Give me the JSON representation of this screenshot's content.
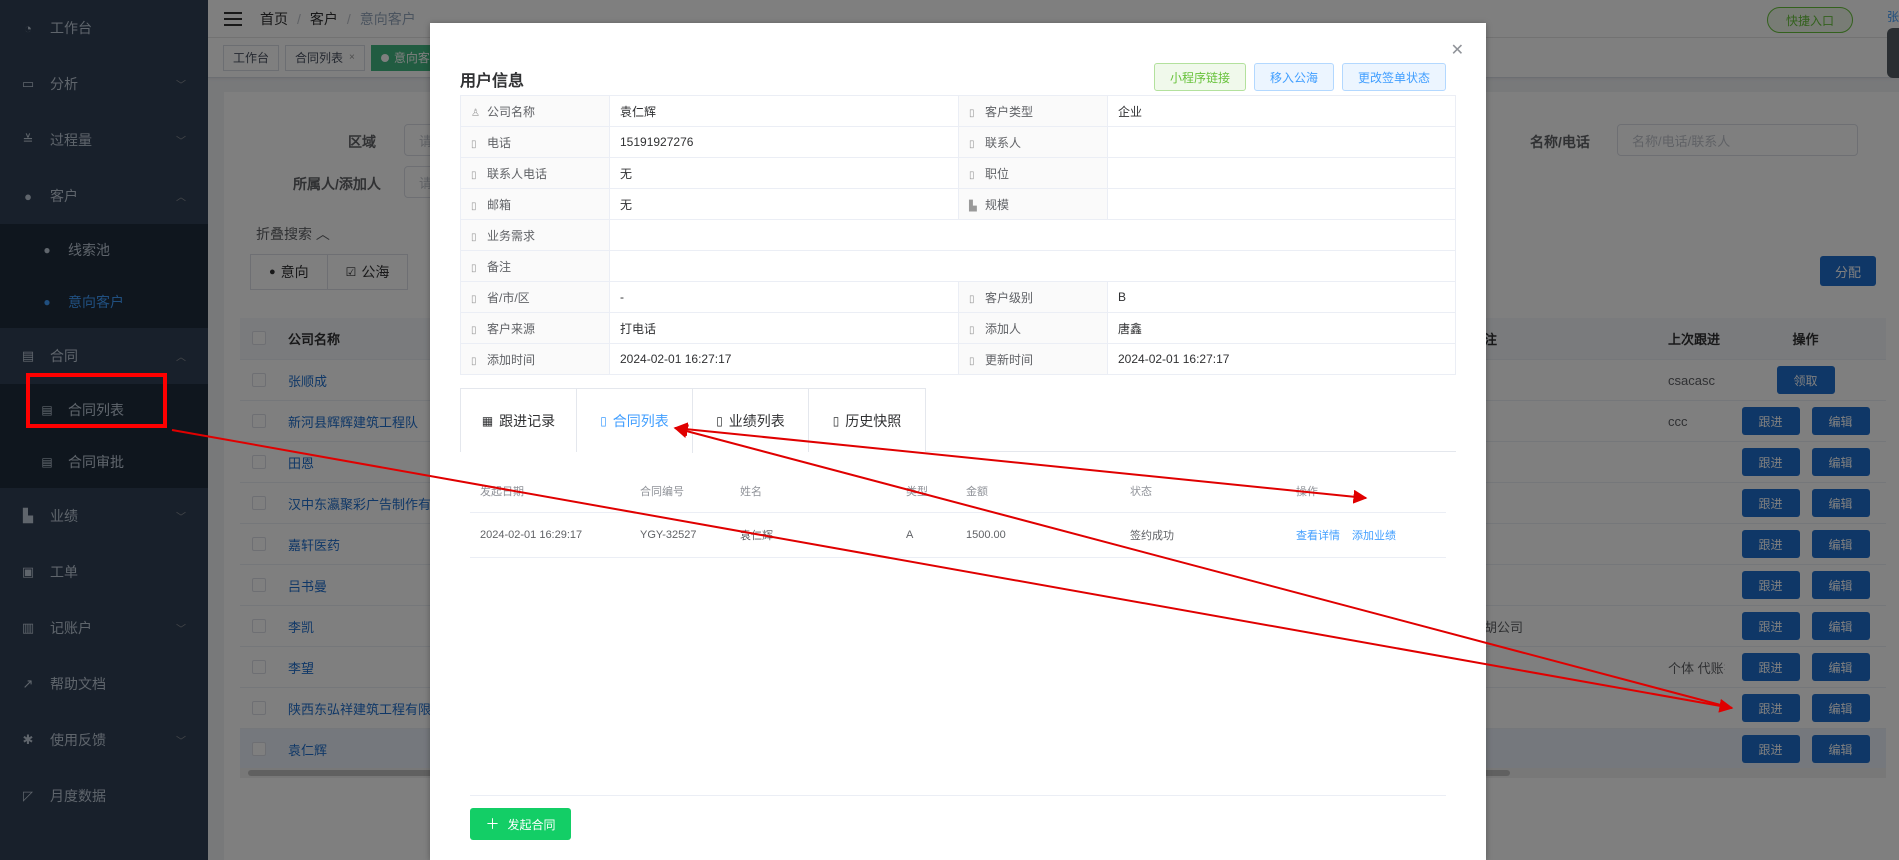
{
  "sidebar": {
    "items": [
      {
        "label": "工作台",
        "icon": "dashboard-icon",
        "chev": ""
      },
      {
        "label": "分析",
        "icon": "monitor-icon",
        "chev": "﹀"
      },
      {
        "label": "过程量",
        "icon": "checklist-icon",
        "chev": "﹀"
      },
      {
        "label": "客户",
        "icon": "user-icon",
        "chev": "︿"
      }
    ],
    "customer_sub": [
      {
        "label": "线索池",
        "icon": "user-icon"
      },
      {
        "label": "意向客户",
        "icon": "user-icon"
      }
    ],
    "contract": {
      "label": "合同",
      "icon": "document-icon",
      "chev": "︿"
    },
    "contract_sub": [
      {
        "label": "合同列表",
        "icon": "document-icon"
      },
      {
        "label": "合同审批",
        "icon": "document-icon"
      }
    ],
    "items_after": [
      {
        "label": "业绩",
        "icon": "chart-bar-icon",
        "chev": "﹀"
      },
      {
        "label": "工单",
        "icon": "clipboard-icon",
        "chev": ""
      },
      {
        "label": "记账户",
        "icon": "ledger-icon",
        "chev": "﹀"
      },
      {
        "label": "帮助文档",
        "icon": "external-link-icon",
        "chev": ""
      },
      {
        "label": "使用反馈",
        "icon": "bug-icon",
        "chev": "﹀"
      },
      {
        "label": "月度数据",
        "icon": "line-chart-icon",
        "chev": ""
      }
    ]
  },
  "topbar": {
    "breadcrumb": [
      "首页",
      "客户",
      "意向客户"
    ],
    "quick_entry": "快捷入口",
    "user_fragment": "张"
  },
  "tags": [
    "工作台",
    "合同列表",
    "意向客户"
  ],
  "filters": {
    "region_label": "区域",
    "region_placeholder": "请选择",
    "owner_label": "所属人/添加人",
    "owner_placeholder": "请选择",
    "name_label": "名称/电话",
    "name_placeholder": "名称/电话/联系人",
    "collapse": "折叠搜索 ︿"
  },
  "segments": [
    {
      "label": "意向",
      "icon": "user-icon"
    },
    {
      "label": "公海",
      "icon": "check-square-icon"
    }
  ],
  "assign_button": "分配",
  "table": {
    "headers": {
      "company": "公司名称",
      "remark": "注",
      "last_follow": "上次跟进",
      "ops": "操作"
    },
    "rows": [
      {
        "company": "张顺成",
        "remark": "",
        "last": "csacasc",
        "ops": [
          "领取"
        ]
      },
      {
        "company": "新河县辉辉建筑工程队",
        "remark": "",
        "last": "ccc",
        "ops": [
          "跟进",
          "编辑"
        ]
      },
      {
        "company": "田恩",
        "remark": "",
        "last": "",
        "ops": [
          "跟进",
          "编辑"
        ]
      },
      {
        "company": "汉中东瀛聚彩广告制作有限",
        "remark": "",
        "last": "",
        "ops": [
          "跟进",
          "编辑"
        ]
      },
      {
        "company": "嘉轩医药",
        "remark": "",
        "last": "",
        "ops": [
          "跟进",
          "编辑"
        ]
      },
      {
        "company": "吕书曼",
        "remark": "",
        "last": "",
        "ops": [
          "跟进",
          "编辑"
        ]
      },
      {
        "company": "李凯",
        "remark": "胡公司",
        "last": "",
        "ops": [
          "跟进",
          "编辑"
        ]
      },
      {
        "company": "李望",
        "remark": "",
        "last": "个体 代账扌",
        "ops": [
          "跟进",
          "编辑"
        ]
      },
      {
        "company": "陕西东弘祥建筑工程有限公",
        "remark": "",
        "last": "",
        "ops": [
          "跟进",
          "编辑"
        ]
      },
      {
        "company": "袁仁辉",
        "remark": "",
        "last": "",
        "ops": [
          "跟进",
          "编辑"
        ]
      }
    ]
  },
  "modal": {
    "title": "用户信息",
    "buttons": [
      "小程序链接",
      "移入公海",
      "更改签单状态"
    ],
    "info": {
      "company_label": "公司名称",
      "company": "袁仁辉",
      "type_label": "客户类型",
      "type": "企业",
      "phone_label": "电话",
      "phone": "15191927276",
      "contact_label": "联系人",
      "contact": "",
      "contact_phone_label": "联系人电话",
      "contact_phone": "无",
      "position_label": "职位",
      "position": "",
      "email_label": "邮箱",
      "email": "无",
      "scale_label": "规模",
      "scale": "",
      "demand_label": "业务需求",
      "demand": "",
      "note_label": "备注",
      "note": "",
      "region_label": "省/市/区",
      "region": "-",
      "level_label": "客户级别",
      "level": "B",
      "source_label": "客户来源",
      "source": "打电话",
      "adder_label": "添加人",
      "adder": "唐鑫",
      "added_label": "添加时间",
      "added": "2024-02-01 16:27:17",
      "updated_label": "更新时间",
      "updated": "2024-02-01 16:27:17"
    },
    "tabs": [
      "跟进记录",
      "合同列表",
      "业绩列表",
      "历史快照"
    ],
    "contract_table": {
      "headers": [
        "发起日期",
        "合同编号",
        "姓名",
        "类型",
        "金额",
        "状态",
        "操作"
      ],
      "row": {
        "date": "2024-02-01 16:29:17",
        "number": "YGY-32527",
        "name": "袁仁辉",
        "type": "A",
        "amount": "1500.00",
        "status": "签约成功",
        "view": "查看详情",
        "add": "添加业绩"
      }
    },
    "launch_button": "发起合同"
  },
  "colors": {
    "sidebar": "#304156",
    "primary": "#1f6fce",
    "annotation": "#ff0000",
    "success": "#13ce66"
  }
}
